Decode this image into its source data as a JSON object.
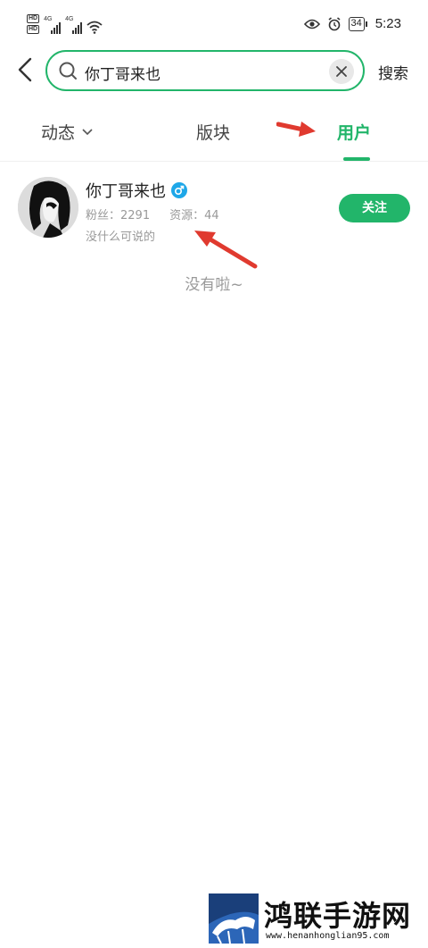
{
  "status_bar": {
    "hd_labels": [
      "HD",
      "HD"
    ],
    "network_labels": [
      "4G",
      "4G"
    ],
    "battery": "34",
    "time": "5:23"
  },
  "search": {
    "query": "你丁哥来也",
    "submit_label": "搜索"
  },
  "tabs": [
    {
      "label": "动态",
      "active": false
    },
    {
      "label": "版块",
      "active": false
    },
    {
      "label": "用户",
      "active": true
    }
  ],
  "accent_color": "#22b56a",
  "results": [
    {
      "name": "你丁哥来也",
      "gender_icon": "male-icon",
      "followers_text": "粉丝：2291",
      "resources_text": "资源：44",
      "bio": "没什么可说的",
      "follow_label": "关注"
    }
  ],
  "end_of_list": "没有啦~",
  "watermark": {
    "title": "鸿联手游网",
    "url": "www.henanhonglian95.com"
  }
}
